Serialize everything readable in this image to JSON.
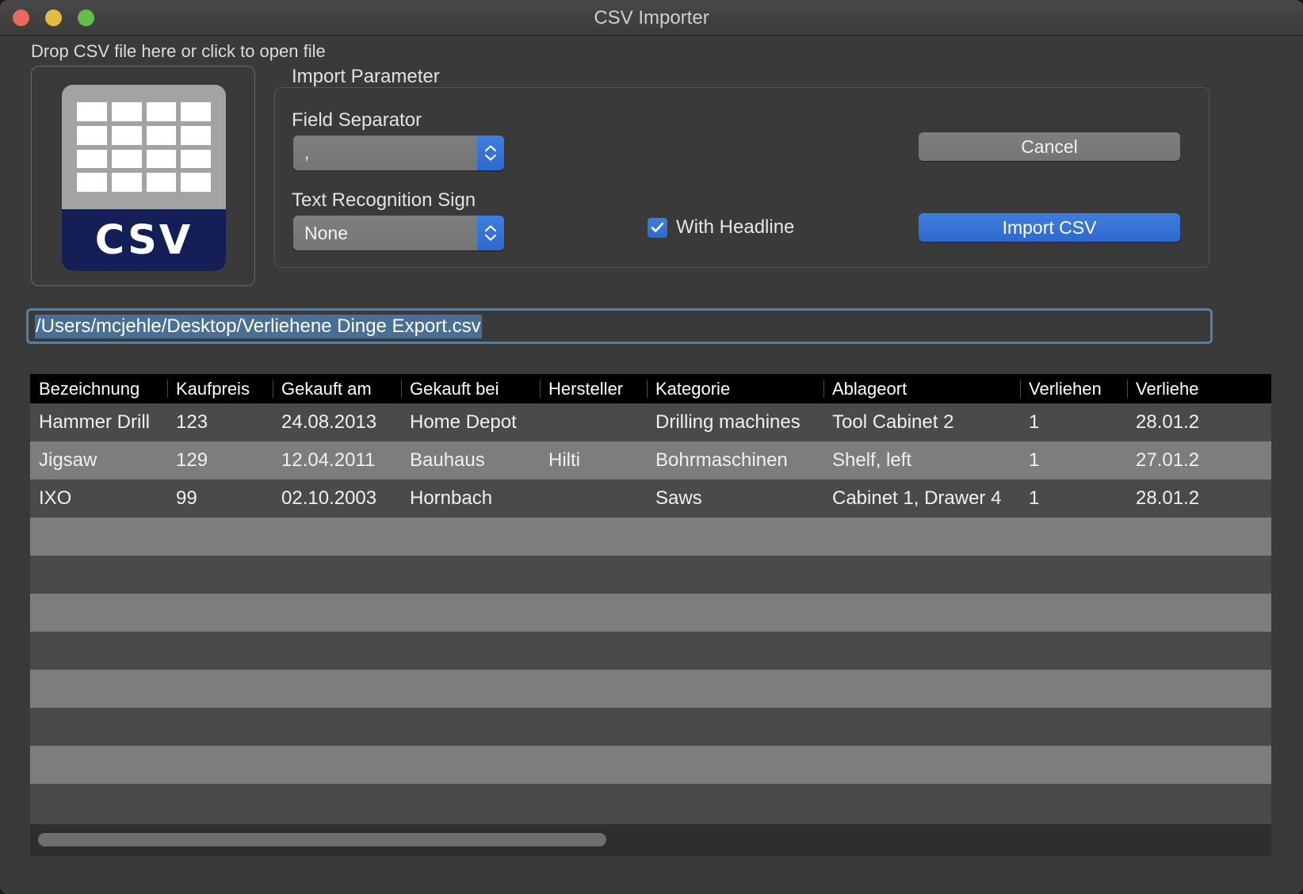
{
  "window": {
    "title": "CSV Importer",
    "traffic_lights": [
      "close",
      "minimize",
      "maximize"
    ]
  },
  "drop": {
    "label": "Drop CSV file here or click to open file",
    "icon_label": "CSV"
  },
  "params": {
    "legend": "Import Parameter",
    "field_separator_label": "Field Separator",
    "field_separator_value": ",",
    "text_recognition_label": "Text Recognition Sign",
    "text_recognition_value": "None",
    "with_headline_label": "With Headline",
    "with_headline_checked": true
  },
  "buttons": {
    "cancel": "Cancel",
    "import": "Import CSV"
  },
  "path": {
    "value": "/Users/mcjehle/Desktop/Verliehene Dinge Export.csv"
  },
  "colors": {
    "accent_blue": "#2f68cd",
    "selection_blue": "#4a6f95",
    "focus_border": "#4f80b0",
    "header_black": "#000000",
    "row_dark": "#4a4a4a",
    "row_light": "#7d7d7d",
    "window_bg": "#3a3a3a",
    "csv_icon_gray": "#a2a4a4",
    "csv_icon_navy": "#141f58"
  },
  "table": {
    "columns": [
      "Bezeichnung",
      "Kaufpreis",
      "Gekauft am",
      "Gekauft bei",
      "Hersteller",
      "Kategorie",
      "Ablageort",
      "Verliehen",
      "Verliehe"
    ],
    "rows": [
      [
        "Hammer Drill",
        "123",
        "24.08.2013",
        "Home Depot",
        "",
        "Drilling machines",
        "Tool Cabinet 2",
        "1",
        "28.01.2"
      ],
      [
        "Jigsaw",
        "129",
        "12.04.2011",
        "Bauhaus",
        "Hilti",
        "Bohrmaschinen",
        "Shelf, left",
        "1",
        "27.01.2"
      ],
      [
        "IXO",
        "99",
        "02.10.2003",
        "Hornbach",
        "",
        "Saws",
        "Cabinet 1, Drawer 4",
        "1",
        "28.01.2"
      ],
      [
        "",
        "",
        "",
        "",
        "",
        "",
        "",
        "",
        ""
      ],
      [
        "",
        "",
        "",
        "",
        "",
        "",
        "",
        "",
        ""
      ],
      [
        "",
        "",
        "",
        "",
        "",
        "",
        "",
        "",
        ""
      ],
      [
        "",
        "",
        "",
        "",
        "",
        "",
        "",
        "",
        ""
      ],
      [
        "",
        "",
        "",
        "",
        "",
        "",
        "",
        "",
        ""
      ],
      [
        "",
        "",
        "",
        "",
        "",
        "",
        "",
        "",
        ""
      ],
      [
        "",
        "",
        "",
        "",
        "",
        "",
        "",
        "",
        ""
      ],
      [
        "",
        "",
        "",
        "",
        "",
        "",
        "",
        "",
        ""
      ]
    ]
  }
}
